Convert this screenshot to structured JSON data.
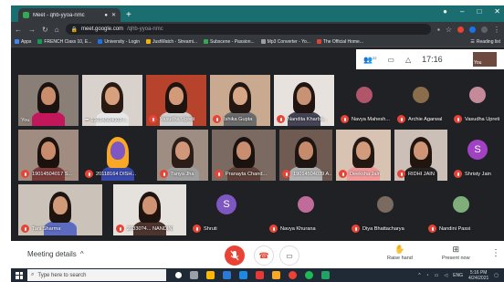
{
  "browser": {
    "tab_title": "Meet - qhb-yyoa-nmc",
    "new_tab": "+",
    "window_controls": [
      "–",
      "□",
      "✕"
    ],
    "url_host": "meet.google.com",
    "url_path": "/qhb-yyoa-nmc",
    "bookmarks": [
      {
        "label": "Apps",
        "color": "#4285f4"
      },
      {
        "label": "FRENCH Class 10, E...",
        "color": "#0f9d58"
      },
      {
        "label": "University - Login",
        "color": "#1a73e8"
      },
      {
        "label": "JustWatch - Streami...",
        "color": "#f4b400"
      },
      {
        "label": "Subscene - Passion...",
        "color": "#34a853"
      },
      {
        "label": "Mp3 Converter - Yo...",
        "color": "#9e9e9e"
      },
      {
        "label": "The Official Home...",
        "color": "#db4437"
      }
    ],
    "reading_list": "Reading list"
  },
  "meet_panel": {
    "people_count": "22",
    "time": "17:16",
    "self_label": "You"
  },
  "participants": [
    {
      "name": "You",
      "muted": false,
      "scene": "you"
    },
    {
      "name": "19014504009 I...",
      "muted": false,
      "more": "•••",
      "scene": "p2"
    },
    {
      "name": "Vasudha Upreti",
      "muted": true,
      "scene": "p3"
    },
    {
      "name": "Ishika Gupta",
      "muted": true,
      "scene": "p4"
    },
    {
      "name": "Nandita Kharba...",
      "muted": true,
      "scene": "p5"
    },
    {
      "name": "Navya Mahesh...",
      "muted": true,
      "scene": "avatar",
      "avatar_color": "#b0556a"
    },
    {
      "name": "Archie Agarwal",
      "muted": true,
      "scene": "avatar",
      "avatar_color": "#8a6d4a"
    },
    {
      "name": "Vasudha Upreti",
      "muted": true,
      "scene": "avatar",
      "avatar_color": "#c48a9a"
    },
    {
      "name": "19014504017 S...",
      "muted": true,
      "scene": "p9"
    },
    {
      "name": "20118164 DISH...",
      "muted": true,
      "scene": "p10"
    },
    {
      "name": "Tanya Jha",
      "muted": true,
      "scene": "p11"
    },
    {
      "name": "Pranayta Chand...",
      "muted": true,
      "scene": "p12"
    },
    {
      "name": "19014504039 A...",
      "muted": true,
      "scene": "p13"
    },
    {
      "name": "Deeksha Jain",
      "muted": true,
      "scene": "p14"
    },
    {
      "name": "RIDHI JAIN",
      "muted": true,
      "scene": "p15"
    },
    {
      "name": "Shristy Jain",
      "muted": true,
      "scene": "avatar",
      "avatar_color": "#a142c4",
      "initial": "S"
    },
    {
      "name": "Tani Sharma",
      "muted": true,
      "scene": "p17"
    },
    {
      "name": "20330?4... NANDINI",
      "muted": true,
      "scene": "p18"
    },
    {
      "name": "Shruti",
      "muted": true,
      "scene": "avatar",
      "avatar_color": "#7e57c2",
      "initial": "S"
    },
    {
      "name": "Navya Khurana",
      "muted": true,
      "scene": "avatar",
      "avatar_color": "#c06c9a"
    },
    {
      "name": "Diya Bhattacharya",
      "muted": true,
      "scene": "avatar",
      "avatar_color": "#7a6a60"
    },
    {
      "name": "Nandini Passi",
      "muted": true,
      "scene": "avatar",
      "avatar_color": "#7fae7a"
    }
  ],
  "bottom_bar": {
    "meeting_details": "Meeting details",
    "raise_hand": "Raise hand",
    "present_now": "Present now"
  },
  "taskbar": {
    "search_placeholder": "Type here to search",
    "lang": "ENG",
    "time": "5:16 PM",
    "date": "4/24/2021"
  }
}
